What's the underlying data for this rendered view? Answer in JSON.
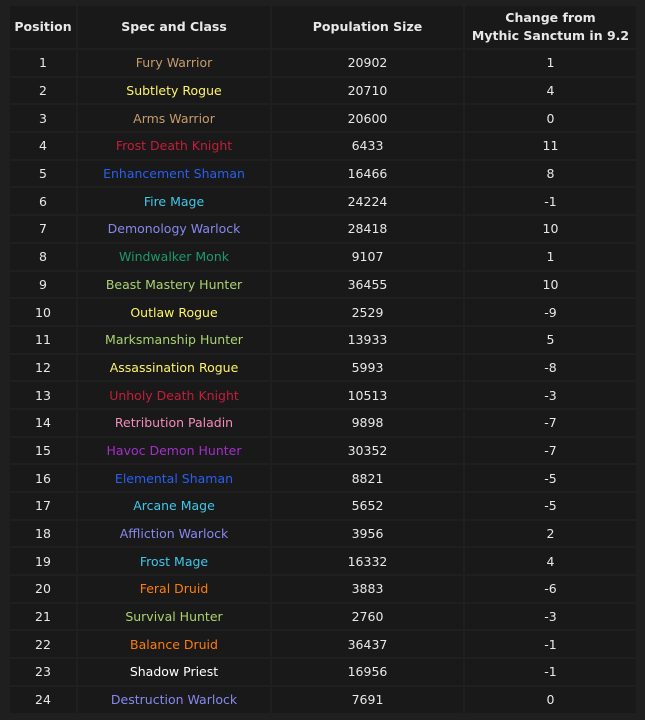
{
  "headers": [
    "Position",
    "Spec and Class",
    "Population Size",
    "Change from",
    "Mythic Sanctum in 9.2"
  ],
  "class_colors": {
    "Warrior": "#C69B6D",
    "Rogue": "#FFF468",
    "Death Knight": "#C41E3A",
    "Shaman": "#2a5ff0",
    "Mage": "#3FC7EB",
    "Warlock": "#8788EE",
    "Monk": "#1d9a6a",
    "Hunter": "#AAD372",
    "Paladin": "#F48CBA",
    "Demon Hunter": "#A330C9",
    "Druid": "#FF7C0A",
    "Priest": "#FFFFFF"
  },
  "rows": [
    {
      "position": "1",
      "spec": "Fury Warrior",
      "class": "Warrior",
      "population": "20902",
      "change": "1"
    },
    {
      "position": "2",
      "spec": "Subtlety Rogue",
      "class": "Rogue",
      "population": "20710",
      "change": "4"
    },
    {
      "position": "3",
      "spec": "Arms Warrior",
      "class": "Warrior",
      "population": "20600",
      "change": "0"
    },
    {
      "position": "4",
      "spec": "Frost Death Knight",
      "class": "Death Knight",
      "population": "6433",
      "change": "11"
    },
    {
      "position": "5",
      "spec": "Enhancement Shaman",
      "class": "Shaman",
      "population": "16466",
      "change": "8"
    },
    {
      "position": "6",
      "spec": "Fire Mage",
      "class": "Mage",
      "population": "24224",
      "change": "-1"
    },
    {
      "position": "7",
      "spec": "Demonology Warlock",
      "class": "Warlock",
      "population": "28418",
      "change": "10"
    },
    {
      "position": "8",
      "spec": "Windwalker Monk",
      "class": "Monk",
      "population": "9107",
      "change": "1"
    },
    {
      "position": "9",
      "spec": "Beast Mastery Hunter",
      "class": "Hunter",
      "population": "36455",
      "change": "10"
    },
    {
      "position": "10",
      "spec": "Outlaw Rogue",
      "class": "Rogue",
      "population": "2529",
      "change": "-9"
    },
    {
      "position": "11",
      "spec": "Marksmanship Hunter",
      "class": "Hunter",
      "population": "13933",
      "change": "5"
    },
    {
      "position": "12",
      "spec": "Assassination Rogue",
      "class": "Rogue",
      "population": "5993",
      "change": "-8"
    },
    {
      "position": "13",
      "spec": "Unholy Death Knight",
      "class": "Death Knight",
      "population": "10513",
      "change": "-3"
    },
    {
      "position": "14",
      "spec": "Retribution Paladin",
      "class": "Paladin",
      "population": "9898",
      "change": "-7"
    },
    {
      "position": "15",
      "spec": "Havoc Demon Hunter",
      "class": "Demon Hunter",
      "population": "30352",
      "change": "-7"
    },
    {
      "position": "16",
      "spec": "Elemental Shaman",
      "class": "Shaman",
      "population": "8821",
      "change": "-5"
    },
    {
      "position": "17",
      "spec": "Arcane Mage",
      "class": "Mage",
      "population": "5652",
      "change": "-5"
    },
    {
      "position": "18",
      "spec": "Affliction Warlock",
      "class": "Warlock",
      "population": "3956",
      "change": "2"
    },
    {
      "position": "19",
      "spec": "Frost Mage",
      "class": "Mage",
      "population": "16332",
      "change": "4"
    },
    {
      "position": "20",
      "spec": "Feral Druid",
      "class": "Druid",
      "population": "3883",
      "change": "-6"
    },
    {
      "position": "21",
      "spec": "Survival Hunter",
      "class": "Hunter",
      "population": "2760",
      "change": "-3"
    },
    {
      "position": "22",
      "spec": "Balance Druid",
      "class": "Druid",
      "population": "36437",
      "change": "-1"
    },
    {
      "position": "23",
      "spec": "Shadow Priest",
      "class": "Priest",
      "population": "16956",
      "change": "-1"
    },
    {
      "position": "24",
      "spec": "Destruction Warlock",
      "class": "Warlock",
      "population": "7691",
      "change": "0"
    }
  ]
}
